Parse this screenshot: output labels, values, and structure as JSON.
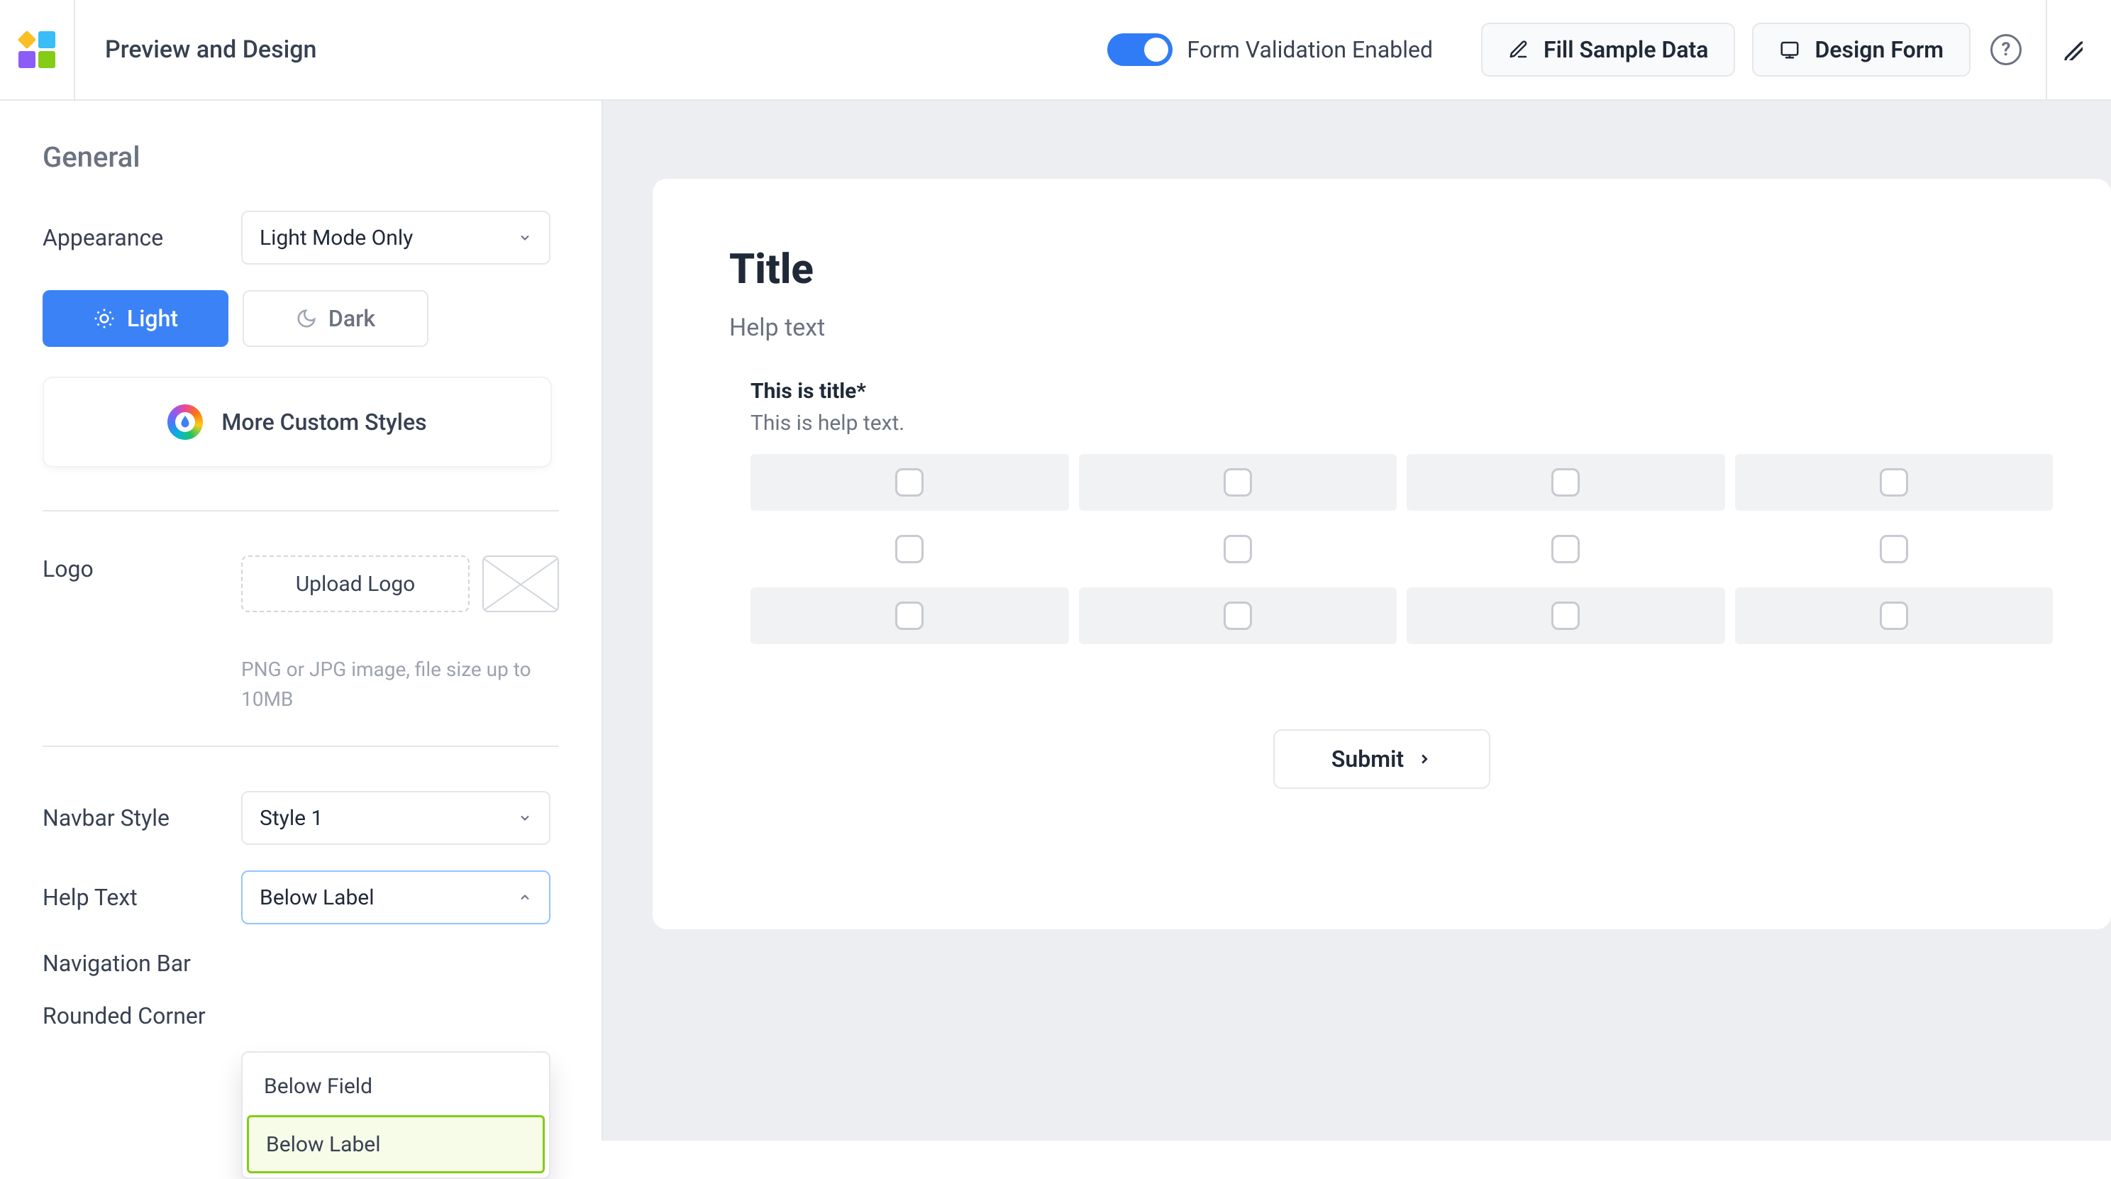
{
  "header": {
    "title": "Preview and Design",
    "validation_label": "Form Validation Enabled",
    "validation_enabled": true,
    "fill_sample": "Fill Sample Data",
    "design_form": "Design Form"
  },
  "sidebar": {
    "section": "General",
    "appearance": {
      "label": "Appearance",
      "value": "Light Mode Only"
    },
    "theme": {
      "light": "Light",
      "dark": "Dark",
      "active": "light"
    },
    "more_custom": "More Custom Styles",
    "logo": {
      "label": "Logo",
      "upload": "Upload Logo",
      "hint": "PNG or JPG image, file size up to 10MB"
    },
    "navbar_style": {
      "label": "Navbar Style",
      "value": "Style 1"
    },
    "help_text": {
      "label": "Help Text",
      "value": "Below Label",
      "options": [
        "Below Field",
        "Below Label"
      ],
      "selected": "Below Label"
    },
    "navigation_bar": {
      "label": "Navigation Bar"
    },
    "rounded_corner": {
      "label": "Rounded Corner"
    }
  },
  "form": {
    "title": "Title",
    "help": "Help text",
    "field_title": "This is title*",
    "field_help": "This is help text.",
    "grid_rows": 3,
    "grid_cols": 4,
    "submit": "Submit"
  }
}
